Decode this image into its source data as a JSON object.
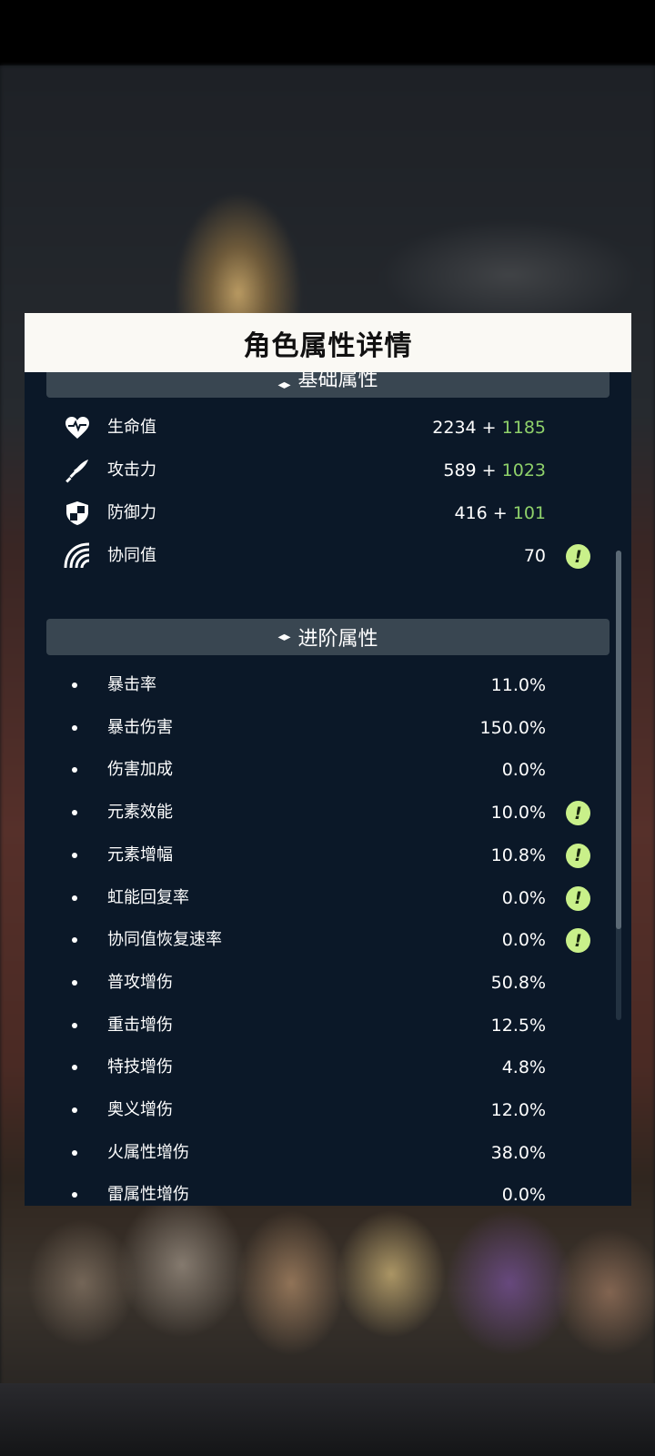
{
  "title": "角色属性详情",
  "basic": {
    "header": "基础属性",
    "rows": [
      {
        "icon": "heart-pulse-icon",
        "label": "生命值",
        "base": "2234",
        "plus": "+",
        "bonus": "1185",
        "warn": false
      },
      {
        "icon": "sword-icon",
        "label": "攻击力",
        "base": "589",
        "plus": "+",
        "bonus": "1023",
        "warn": false
      },
      {
        "icon": "shield-icon",
        "label": "防御力",
        "base": "416",
        "plus": "+",
        "bonus": "101",
        "warn": false
      },
      {
        "icon": "synergy-icon",
        "label": "协同值",
        "base": "70",
        "plus": "",
        "bonus": "",
        "warn": true
      }
    ]
  },
  "advanced": {
    "header": "进阶属性",
    "rows": [
      {
        "label": "暴击率",
        "value": "11.0%",
        "warn": false
      },
      {
        "label": "暴击伤害",
        "value": "150.0%",
        "warn": false
      },
      {
        "label": "伤害加成",
        "value": "0.0%",
        "warn": false
      },
      {
        "label": "元素效能",
        "value": "10.0%",
        "warn": true
      },
      {
        "label": "元素增幅",
        "value": "10.8%",
        "warn": true
      },
      {
        "label": "虹能回复率",
        "value": "0.0%",
        "warn": true
      },
      {
        "label": "协同值恢复速率",
        "value": "0.0%",
        "warn": true
      },
      {
        "label": "普攻增伤",
        "value": "50.8%",
        "warn": false
      },
      {
        "label": "重击增伤",
        "value": "12.5%",
        "warn": false
      },
      {
        "label": "特技增伤",
        "value": "4.8%",
        "warn": false
      },
      {
        "label": "奥义增伤",
        "value": "12.0%",
        "warn": false
      },
      {
        "label": "火属性增伤",
        "value": "38.0%",
        "warn": false
      },
      {
        "label": "雷属性增伤",
        "value": "0.0%",
        "warn": false
      }
    ]
  },
  "warn_glyph": "!",
  "colors": {
    "bonus": "#8fd16a",
    "warn": "#c9f08a",
    "panel": "#0b1828",
    "header": "#faf9f4"
  }
}
